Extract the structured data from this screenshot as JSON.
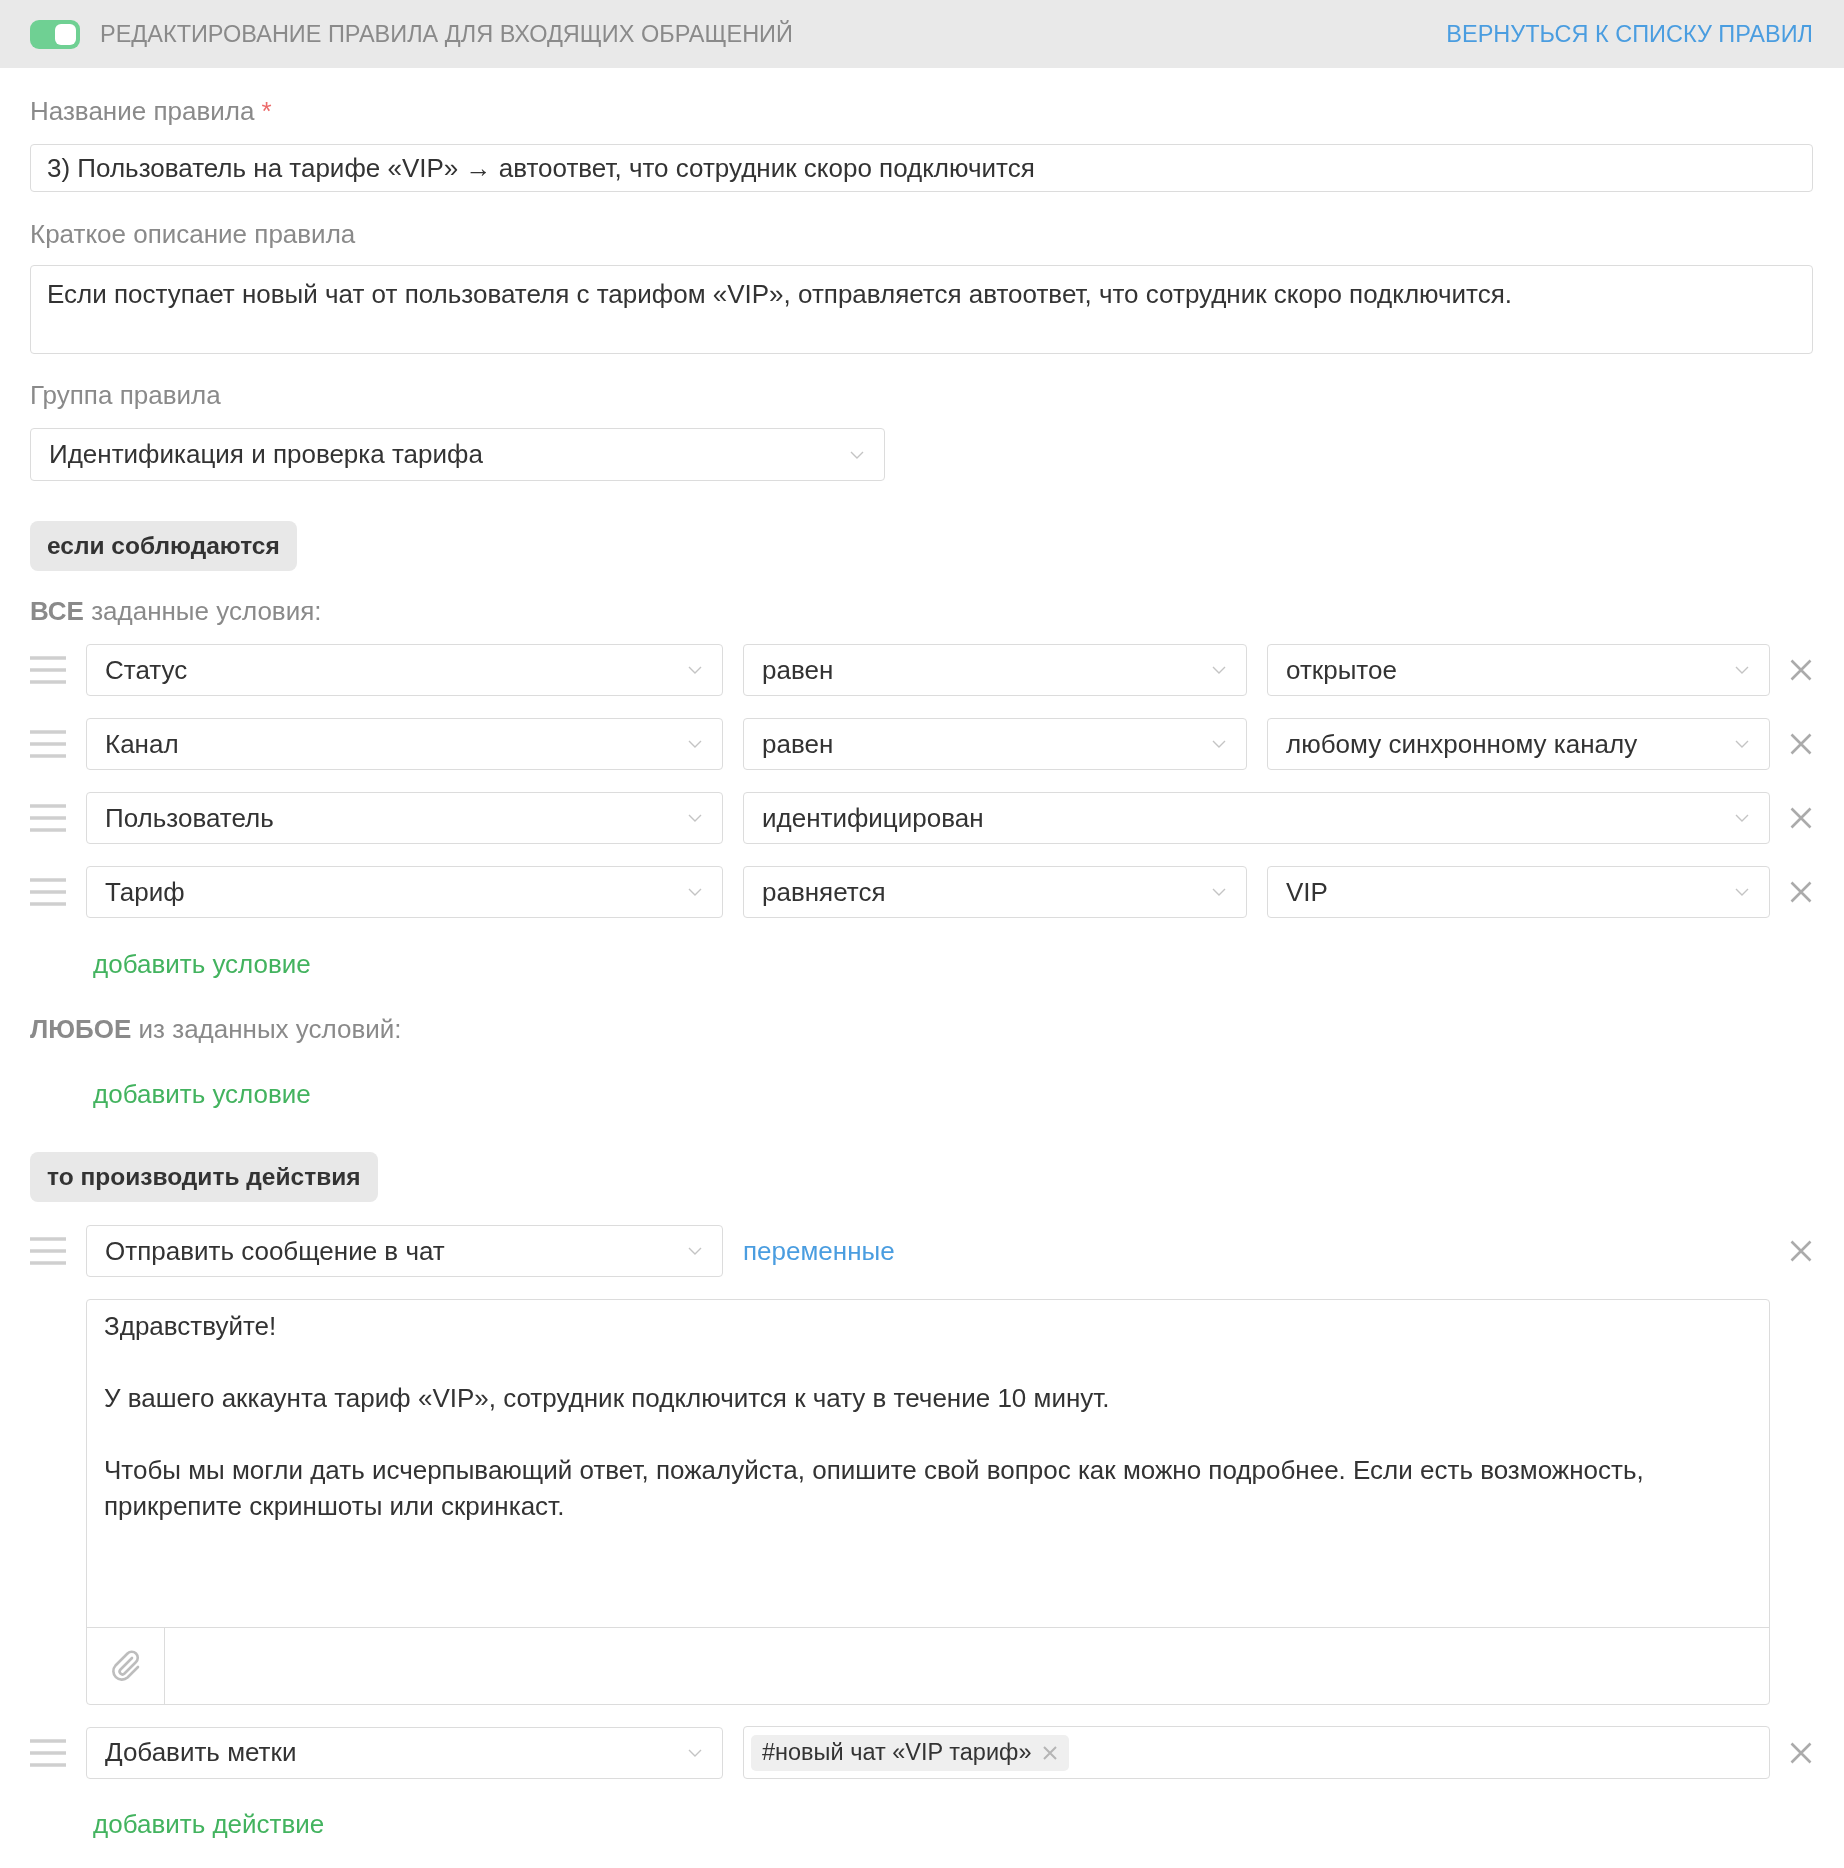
{
  "header": {
    "toggle_on": true,
    "title": "РЕДАКТИРОВАНИЕ ПРАВИЛА ДЛЯ ВХОДЯЩИХ ОБРАЩЕНИЙ",
    "back_link": "ВЕРНУТЬСЯ К СПИСКУ ПРАВИЛ"
  },
  "rule_name": {
    "label": "Название правила",
    "required_mark": "*",
    "value": "3) Пользователь на тарифе «VIP» → автоответ, что сотрудник скоро подключится"
  },
  "description": {
    "label": "Краткое описание правила",
    "value": "Если поступает новый чат от пользователя с тарифом «VIP», отправляется автоответ, что сотрудник скоро подключится."
  },
  "group": {
    "label": "Группа правила",
    "value": "Идентификация и проверка тарифа"
  },
  "conditions": {
    "heading": "если соблюдаются",
    "groups": [
      {
        "label": "**ВСЕ** заданные условия:",
        "rows": [
          {
            "selects": [
              "Статус",
              "равен",
              "открытое"
            ]
          },
          {
            "selects": [
              "Канал",
              "равен",
              "любому синхронному каналу"
            ]
          },
          {
            "selects": [
              "Пользователь",
              "идентифицирован"
            ]
          },
          {
            "selects": [
              "Тариф",
              "равняется",
              "VIP"
            ]
          }
        ],
        "add_link": "добавить условие"
      },
      {
        "label": "**ЛЮБОЕ** из заданных условий:",
        "add_link": "добавить условие"
      }
    ]
  },
  "actions": {
    "heading": "то производить действия",
    "rows": [
      {
        "kind": "message",
        "select": "Отправить сообщение в чат",
        "variables_link": "переменные",
        "message": [
          "Здравствуйте!",
          "У вашего аккаунта тариф «VIP», сотрудник подключится к чату в течение 10 минут.",
          "Чтобы мы могли дать исчерпывающий ответ, пожалуйста, опишите свой вопрос как можно подробнее. Если есть возможность, прикрепите скриншоты или скринкаст."
        ]
      },
      {
        "kind": "tags",
        "select": "Добавить метки",
        "tags": [
          "#новый чат «VIP тариф»"
        ]
      }
    ],
    "add_link": "добавить действие"
  }
}
